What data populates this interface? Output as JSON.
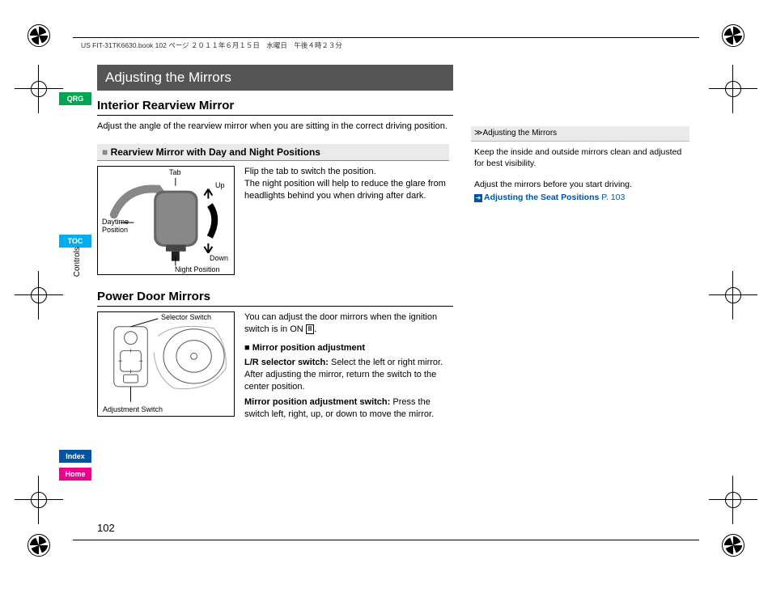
{
  "header_text": "US FIT-31TK6630.book  102 ページ  ２０１１年６月１５日　水曜日　午後４時２３分",
  "title": "Adjusting the Mirrors",
  "h2_interior": "Interior Rearview Mirror",
  "intro": "Adjust the angle of the rearview mirror when you are sitting in the correct driving position.",
  "sub_day_night": "Rearview Mirror with Day and Night Positions",
  "fig1": {
    "tab": "Tab",
    "up": "Up",
    "down": "Down",
    "daytime": "Daytime Position",
    "night": "Night Position"
  },
  "fig1_text1": "Flip the tab to switch the position.",
  "fig1_text2": "The night position will help to reduce the glare from headlights behind you when driving after dark.",
  "h2_power": "Power Door Mirrors",
  "fig2": {
    "selector": "Selector Switch",
    "adjust": "Adjustment Switch"
  },
  "fig2_intro_a": "You can adjust the door mirrors when the ignition switch is in ON ",
  "fig2_intro_b": ".",
  "on_label": "II",
  "sub_mpa": "■ Mirror position adjustment",
  "lr_label": "L/R selector switch:",
  "lr_text": " Select the left or right mirror. After adjusting the mirror, return the switch to the center position.",
  "mpas_label": "Mirror position adjustment switch:",
  "mpas_text": " Press the switch left, right, up, or down to move the mirror.",
  "nav": {
    "qrg": "QRG",
    "toc": "TOC",
    "index": "Index",
    "home": "Home",
    "section": "Controls"
  },
  "sidebar": {
    "head_marker": "≫",
    "head": "Adjusting the Mirrors",
    "p1": "Keep the inside and outside mirrors clean and adjusted for best visibility.",
    "p2": "Adjust the mirrors before you start driving.",
    "link_text": "Adjusting the Seat Positions",
    "link_page": "P. 103"
  },
  "page_number": "102"
}
